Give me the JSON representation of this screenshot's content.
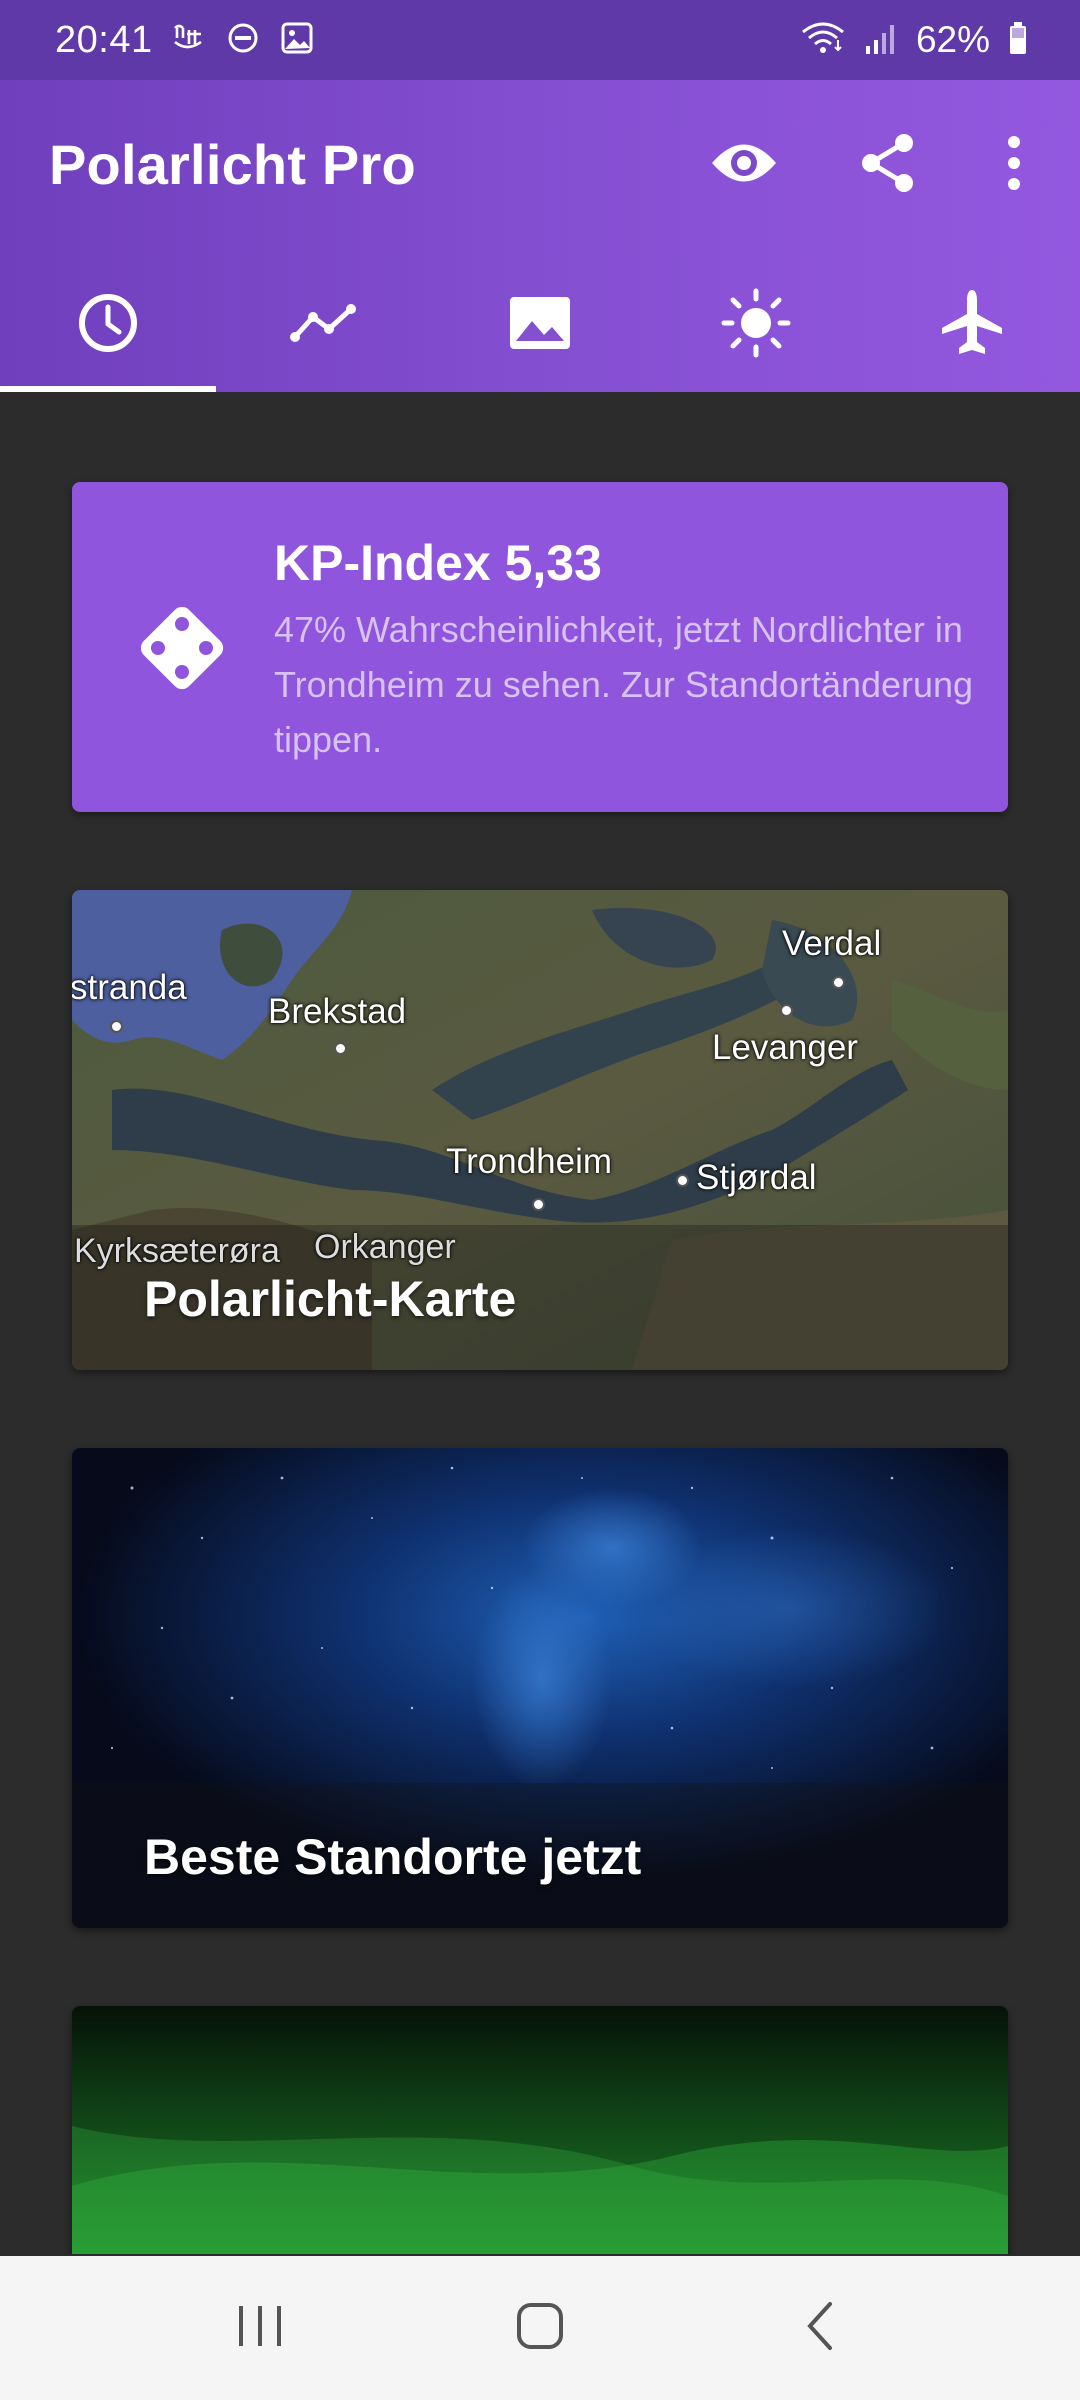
{
  "status_bar": {
    "time": "20:41",
    "battery": "62%",
    "icons": [
      "notification-app-icon",
      "do-not-disturb-icon",
      "gallery-icon",
      "wifi-icon",
      "signal-icon",
      "battery-icon"
    ]
  },
  "app_bar": {
    "title": "Polarlicht Pro",
    "actions": [
      "eye-icon",
      "share-icon",
      "more-vert-icon"
    ]
  },
  "tabs": [
    {
      "icon": "clock-icon",
      "selected": true
    },
    {
      "icon": "chart-line-icon",
      "selected": false
    },
    {
      "icon": "image-icon",
      "selected": false
    },
    {
      "icon": "sun-icon",
      "selected": false
    },
    {
      "icon": "airplane-icon",
      "selected": false
    }
  ],
  "kp_card": {
    "title": "KP-Index 5,33",
    "description": "47% Wahrscheinlichkeit, jetzt Nordlichter in Trondheim zu sehen. Zur Standortänderung tippen.",
    "icon": "dice-icon"
  },
  "map_card": {
    "label": "Polarlicht-Karte",
    "places": {
      "stranda": "stranda",
      "brekstad": "Brekstad",
      "verdal": "Verdal",
      "levanger": "Levanger",
      "trondheim": "Trondheim",
      "stjordal": "Stjørdal",
      "kyrksaeteroera": "Kyrksæterøra",
      "orkanger": "Orkanger"
    }
  },
  "stars_card": {
    "label": "Beste Standorte jetzt"
  },
  "nav_bar": {
    "buttons": [
      "recent-apps-icon",
      "home-icon",
      "back-icon"
    ]
  },
  "colors": {
    "status_bar": "#5e39a7",
    "app_bar": "#8650d3",
    "kp_card": "#8f55dc",
    "background": "#2c2c2c"
  }
}
